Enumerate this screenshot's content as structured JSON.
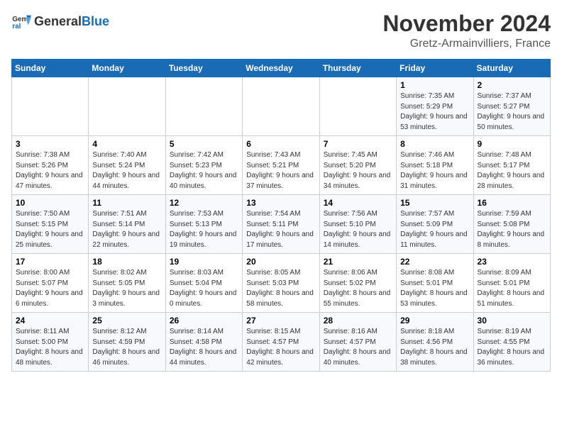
{
  "logo": {
    "text_general": "General",
    "text_blue": "Blue"
  },
  "title": "November 2024",
  "location": "Gretz-Armainvilliers, France",
  "days_of_week": [
    "Sunday",
    "Monday",
    "Tuesday",
    "Wednesday",
    "Thursday",
    "Friday",
    "Saturday"
  ],
  "weeks": [
    [
      {
        "day": "",
        "info": ""
      },
      {
        "day": "",
        "info": ""
      },
      {
        "day": "",
        "info": ""
      },
      {
        "day": "",
        "info": ""
      },
      {
        "day": "",
        "info": ""
      },
      {
        "day": "1",
        "info": "Sunrise: 7:35 AM\nSunset: 5:29 PM\nDaylight: 9 hours and 53 minutes."
      },
      {
        "day": "2",
        "info": "Sunrise: 7:37 AM\nSunset: 5:27 PM\nDaylight: 9 hours and 50 minutes."
      }
    ],
    [
      {
        "day": "3",
        "info": "Sunrise: 7:38 AM\nSunset: 5:26 PM\nDaylight: 9 hours and 47 minutes."
      },
      {
        "day": "4",
        "info": "Sunrise: 7:40 AM\nSunset: 5:24 PM\nDaylight: 9 hours and 44 minutes."
      },
      {
        "day": "5",
        "info": "Sunrise: 7:42 AM\nSunset: 5:23 PM\nDaylight: 9 hours and 40 minutes."
      },
      {
        "day": "6",
        "info": "Sunrise: 7:43 AM\nSunset: 5:21 PM\nDaylight: 9 hours and 37 minutes."
      },
      {
        "day": "7",
        "info": "Sunrise: 7:45 AM\nSunset: 5:20 PM\nDaylight: 9 hours and 34 minutes."
      },
      {
        "day": "8",
        "info": "Sunrise: 7:46 AM\nSunset: 5:18 PM\nDaylight: 9 hours and 31 minutes."
      },
      {
        "day": "9",
        "info": "Sunrise: 7:48 AM\nSunset: 5:17 PM\nDaylight: 9 hours and 28 minutes."
      }
    ],
    [
      {
        "day": "10",
        "info": "Sunrise: 7:50 AM\nSunset: 5:15 PM\nDaylight: 9 hours and 25 minutes."
      },
      {
        "day": "11",
        "info": "Sunrise: 7:51 AM\nSunset: 5:14 PM\nDaylight: 9 hours and 22 minutes."
      },
      {
        "day": "12",
        "info": "Sunrise: 7:53 AM\nSunset: 5:13 PM\nDaylight: 9 hours and 19 minutes."
      },
      {
        "day": "13",
        "info": "Sunrise: 7:54 AM\nSunset: 5:11 PM\nDaylight: 9 hours and 17 minutes."
      },
      {
        "day": "14",
        "info": "Sunrise: 7:56 AM\nSunset: 5:10 PM\nDaylight: 9 hours and 14 minutes."
      },
      {
        "day": "15",
        "info": "Sunrise: 7:57 AM\nSunset: 5:09 PM\nDaylight: 9 hours and 11 minutes."
      },
      {
        "day": "16",
        "info": "Sunrise: 7:59 AM\nSunset: 5:08 PM\nDaylight: 9 hours and 8 minutes."
      }
    ],
    [
      {
        "day": "17",
        "info": "Sunrise: 8:00 AM\nSunset: 5:07 PM\nDaylight: 9 hours and 6 minutes."
      },
      {
        "day": "18",
        "info": "Sunrise: 8:02 AM\nSunset: 5:05 PM\nDaylight: 9 hours and 3 minutes."
      },
      {
        "day": "19",
        "info": "Sunrise: 8:03 AM\nSunset: 5:04 PM\nDaylight: 9 hours and 0 minutes."
      },
      {
        "day": "20",
        "info": "Sunrise: 8:05 AM\nSunset: 5:03 PM\nDaylight: 8 hours and 58 minutes."
      },
      {
        "day": "21",
        "info": "Sunrise: 8:06 AM\nSunset: 5:02 PM\nDaylight: 8 hours and 55 minutes."
      },
      {
        "day": "22",
        "info": "Sunrise: 8:08 AM\nSunset: 5:01 PM\nDaylight: 8 hours and 53 minutes."
      },
      {
        "day": "23",
        "info": "Sunrise: 8:09 AM\nSunset: 5:01 PM\nDaylight: 8 hours and 51 minutes."
      }
    ],
    [
      {
        "day": "24",
        "info": "Sunrise: 8:11 AM\nSunset: 5:00 PM\nDaylight: 8 hours and 48 minutes."
      },
      {
        "day": "25",
        "info": "Sunrise: 8:12 AM\nSunset: 4:59 PM\nDaylight: 8 hours and 46 minutes."
      },
      {
        "day": "26",
        "info": "Sunrise: 8:14 AM\nSunset: 4:58 PM\nDaylight: 8 hours and 44 minutes."
      },
      {
        "day": "27",
        "info": "Sunrise: 8:15 AM\nSunset: 4:57 PM\nDaylight: 8 hours and 42 minutes."
      },
      {
        "day": "28",
        "info": "Sunrise: 8:16 AM\nSunset: 4:57 PM\nDaylight: 8 hours and 40 minutes."
      },
      {
        "day": "29",
        "info": "Sunrise: 8:18 AM\nSunset: 4:56 PM\nDaylight: 8 hours and 38 minutes."
      },
      {
        "day": "30",
        "info": "Sunrise: 8:19 AM\nSunset: 4:55 PM\nDaylight: 8 hours and 36 minutes."
      }
    ]
  ]
}
